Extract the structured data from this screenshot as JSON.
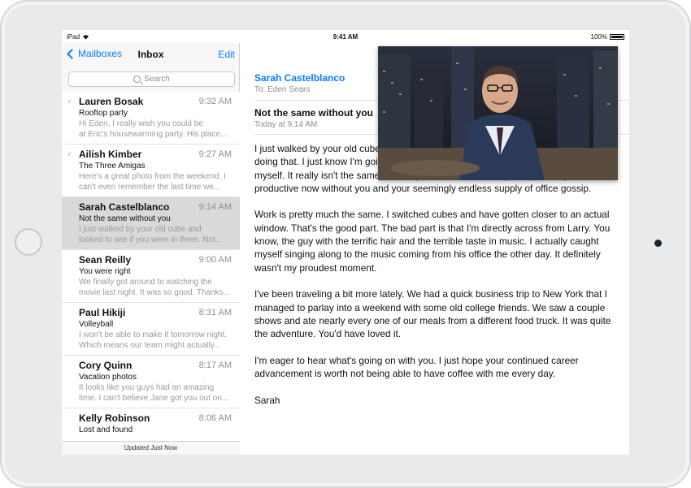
{
  "status": {
    "device": "iPad",
    "time": "9:41 AM",
    "battery": "100%"
  },
  "nav": {
    "back_label": "Mailboxes",
    "title": "Inbox",
    "edit_label": "Edit"
  },
  "search": {
    "placeholder": "Search"
  },
  "emails": [
    {
      "sender": "Lauren Bosak",
      "time": "9:32 AM",
      "subject": "Rooftop party",
      "preview1": "Hi Eden, I really wish you could be",
      "preview2": "at Eric's housewarming party. His place...",
      "attachment": true,
      "selected": false
    },
    {
      "sender": "Ailish Kimber",
      "time": "9:27 AM",
      "subject": "The Three Amigas",
      "preview1": "Here's a great photo from the weekend. I",
      "preview2": "can't even remember the last time we...",
      "attachment": true,
      "selected": false
    },
    {
      "sender": "Sarah Castelblanco",
      "time": "9:14 AM",
      "subject": "Not the same without you",
      "preview1": "I just walked by your old cube and",
      "preview2": "looked to see if you were in there. Not...",
      "attachment": false,
      "selected": true
    },
    {
      "sender": "Sean Reilly",
      "time": "9:00 AM",
      "subject": "You were right",
      "preview1": "We finally got around to watching the",
      "preview2": "movie last night. It was so good. Thanks...",
      "attachment": false,
      "selected": false
    },
    {
      "sender": "Paul Hikiji",
      "time": "8:31 AM",
      "subject": "Volleyball",
      "preview1": "I won't be able to make it tomorrow night.",
      "preview2": "Which means our team might actually...",
      "attachment": false,
      "selected": false
    },
    {
      "sender": "Cory Quinn",
      "time": "8:17 AM",
      "subject": "Vacation photos",
      "preview1": "It looks like you guys had an amazing",
      "preview2": "time. I can't believe Jane got you out on...",
      "attachment": false,
      "selected": false
    },
    {
      "sender": "Kelly Robinson",
      "time": "8:06 AM",
      "subject": "Lost and found",
      "preview1": "",
      "preview2": "",
      "attachment": false,
      "selected": false
    }
  ],
  "toolbar": {
    "status": "Updated Just Now"
  },
  "message": {
    "from": "Sarah Castelblanco",
    "to": "To: Eden Sears",
    "subject": "Not the same without you",
    "date": "Today at 9:14 AM",
    "paragraphs": [
      "I just walked by your old cube and looked to see if you were in there. Not sure I'll stop doing that. I just know I'm going to keep doing it until I'm starting to get annoyed with myself. It really isn't the same without you here, me. Although I'm probably more productive now without you and your seemingly endless supply of office gossip.",
      "Work is pretty much the same. I switched cubes and have gotten closer to an actual window. That's the good part. The bad part is that I'm directly across from Larry. You know, the guy with the terrific hair and the terrible taste in music. I actually caught myself singing along to the music coming from his office the other day. It definitely wasn't my proudest moment.",
      "I've been traveling a bit more lately. We had a quick business trip to New York that I managed to parlay into a weekend with some old college friends. We saw a couple shows and ate nearly every one of our meals from a different food truck. It was quite the adventure. You'd have loved it.",
      "I'm eager to hear what's going on with you. I just hope your continued career advancement is worth not being able to have coffee with me every day.",
      "Sarah"
    ]
  },
  "colors": {
    "accent": "#0a7bff",
    "selected_row": "#d9d9d9",
    "secondary_text": "#8e8e93"
  },
  "icons": {
    "back": "chevron-left-icon",
    "search": "search-icon",
    "attachment": "paperclip-icon",
    "wifi": "wifi-icon",
    "battery": "battery-icon"
  }
}
